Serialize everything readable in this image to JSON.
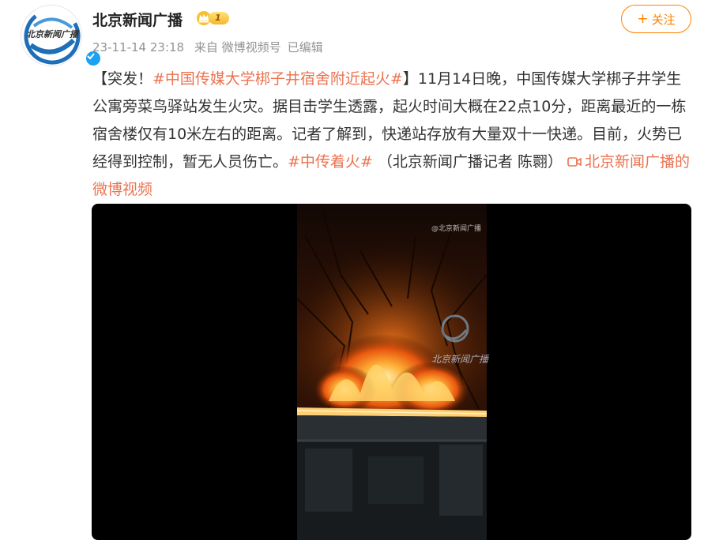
{
  "post": {
    "author": {
      "name": "北京新闻广播",
      "avatar_logo_text": "北京新闻广播",
      "level": "1"
    },
    "time": "23-11-14 23:18",
    "source": "来自 微博视频号",
    "edited": "已编辑",
    "follow_label": "关注",
    "follow_plus": "+",
    "content": {
      "open_bracket": "【突发！",
      "hashtag_1": "#中国传媒大学梆子井宿舍附近起火#",
      "body": "】11月14日晚，中国传媒大学梆子井学生公寓旁菜鸟驿站发生火灾。据目击学生透露，起火时间大概在22点10分，距离最近的一栋宿舍楼仅有10米左右的距离。记者了解到，快递站存放有大量双十一快递。目前，火势已经得到控制，暂无人员伤亡。",
      "hashtag_2": "#中传着火#",
      "credit": " （北京新闻广播记者 陈翾）",
      "video_link": "北京新闻广播的微博视频"
    },
    "video": {
      "watermark_top": "@北京新闻广播",
      "watermark_logo_text": "北京新闻广播"
    }
  },
  "colors": {
    "accent": "#ff8200",
    "hashtag": "#eb7350",
    "meta": "#939393",
    "verified": "#1da1f2"
  }
}
